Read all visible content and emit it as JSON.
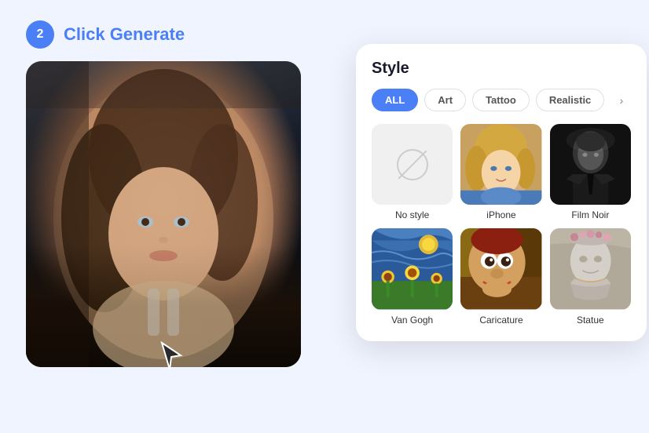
{
  "step": {
    "number": "2",
    "label": "Click Generate"
  },
  "panel": {
    "title": "Style",
    "filters": [
      {
        "id": "all",
        "label": "ALL",
        "active": true
      },
      {
        "id": "art",
        "label": "Art",
        "active": false
      },
      {
        "id": "tattoo",
        "label": "Tattoo",
        "active": false
      },
      {
        "id": "realistic",
        "label": "Realistic",
        "active": false
      }
    ],
    "styles": [
      {
        "id": "no-style",
        "label": "No style",
        "type": "none"
      },
      {
        "id": "iphone",
        "label": "iPhone",
        "type": "iphone"
      },
      {
        "id": "film-noir",
        "label": "Film Noir",
        "type": "film-noir"
      },
      {
        "id": "van-gogh",
        "label": "Van Gogh",
        "type": "van-gogh"
      },
      {
        "id": "caricature",
        "label": "Caricature",
        "type": "caricature"
      },
      {
        "id": "statue",
        "label": "Statue",
        "type": "statue"
      }
    ]
  },
  "chevron_right": "›",
  "colors": {
    "accent": "#4a7ff5",
    "panel_bg": "#ffffff",
    "body_bg": "#f0f4ff"
  }
}
